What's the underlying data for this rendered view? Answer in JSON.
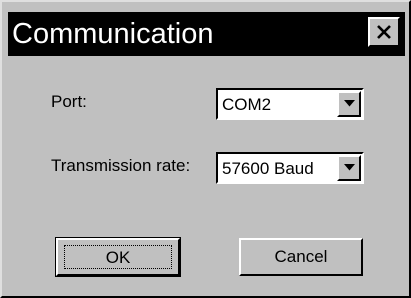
{
  "window": {
    "title": "Communication",
    "close_icon": "close-icon"
  },
  "form": {
    "port_label": "Port:",
    "port_value": "COM2",
    "rate_label": "Transmission rate:",
    "rate_value": "57600 Baud"
  },
  "buttons": {
    "ok_label": "OK",
    "cancel_label": "Cancel"
  },
  "colors": {
    "face": "#c0c0c0",
    "titlebar": "#000000",
    "title_text": "#ffffff"
  }
}
